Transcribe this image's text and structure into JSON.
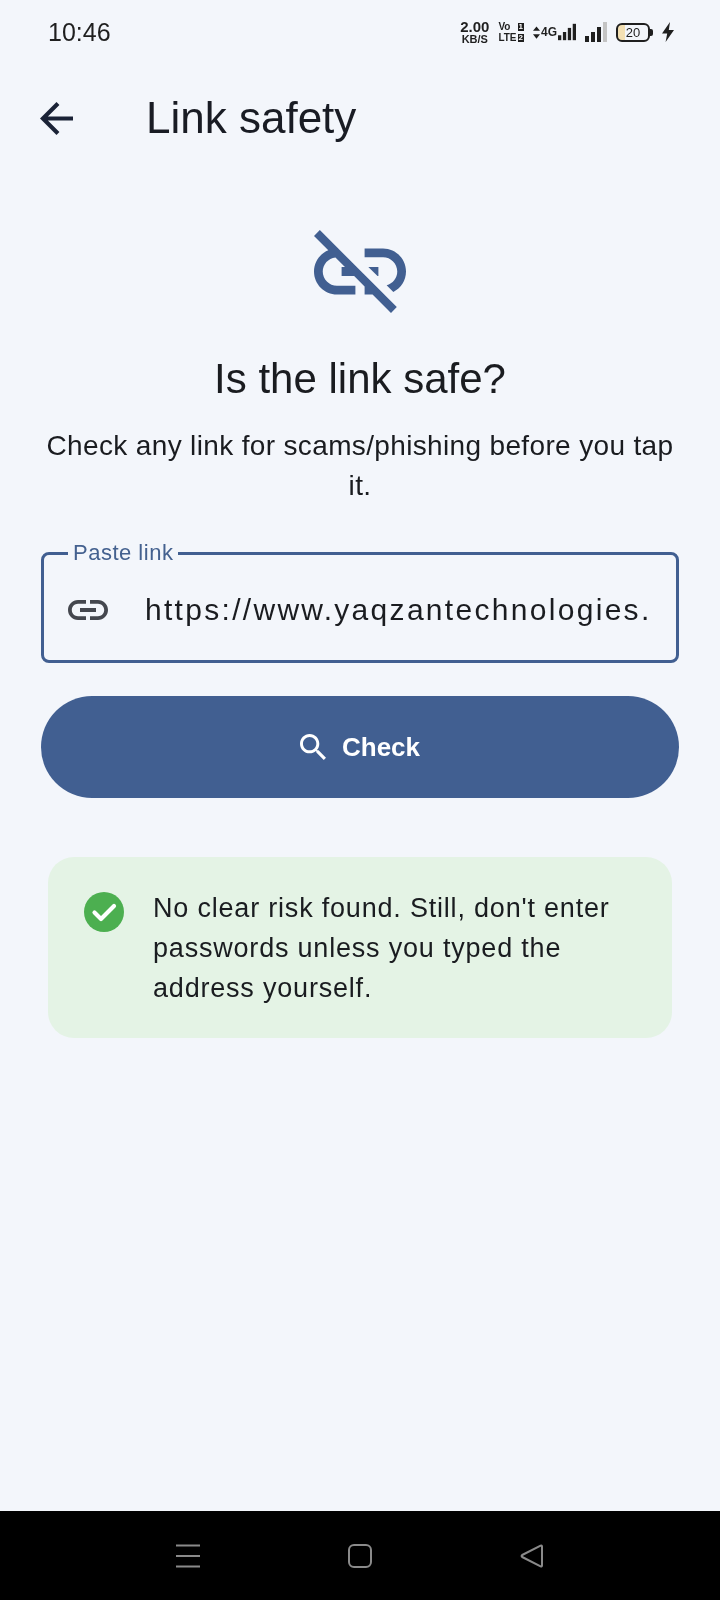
{
  "status_bar": {
    "time": "10:46",
    "net_speed": "2.00",
    "net_unit": "KB/S",
    "volte": {
      "top": "Vo",
      "top_sim": "1",
      "bottom": "LTE",
      "bottom_sim": "2"
    },
    "network_type": "4G",
    "battery": "20",
    "charging": true
  },
  "app_bar": {
    "title": "Link safety"
  },
  "header": {
    "title": "Is the link safe?",
    "subtitle": "Check any link for scams/phishing before you tap it."
  },
  "link_field": {
    "label": "Paste link",
    "value": "https://www.yaqzantechnologies.",
    "focused": true
  },
  "check_button": {
    "label": "Check"
  },
  "result": {
    "safe": true,
    "message": "No clear risk found. Still, don't enter passwords unless you typed the address yourself."
  }
}
